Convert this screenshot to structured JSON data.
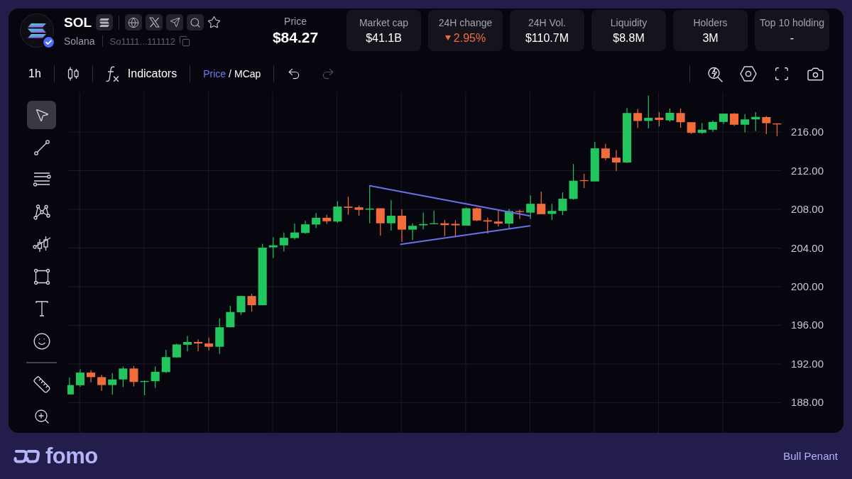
{
  "token": {
    "symbol": "SOL",
    "name": "Solana",
    "address": "So1111...111112",
    "verified": true
  },
  "price": {
    "label": "Price",
    "value": "$84.27"
  },
  "stats": [
    {
      "label": "Market cap",
      "value": "$41.1B"
    },
    {
      "label": "24H change",
      "value": "2.95%",
      "negative": true
    },
    {
      "label": "24H Vol.",
      "value": "$110.7M"
    },
    {
      "label": "Liquidity",
      "value": "$8.8M"
    },
    {
      "label": "Holders",
      "value": "3M"
    },
    {
      "label": "Top 10 holding",
      "value": "-"
    }
  ],
  "toolbar": {
    "interval": "1h",
    "indicators": "Indicators",
    "modes": [
      {
        "label": "Price",
        "selected": true
      },
      {
        "label": "MCap",
        "selected": false
      }
    ],
    "mode_separator": "/",
    "history": [
      {
        "kind": "undo",
        "disabled": false
      },
      {
        "kind": "redo",
        "disabled": true
      }
    ]
  },
  "drawing_tools": [
    {
      "kind": "cursor",
      "selected": true
    },
    {
      "kind": "trend_line",
      "selected": false
    },
    {
      "kind": "parallel_lines",
      "selected": false
    },
    {
      "kind": "pattern",
      "selected": false
    },
    {
      "kind": "candles_line",
      "selected": false
    },
    {
      "kind": "rectangle",
      "selected": false
    },
    {
      "kind": "text",
      "selected": false
    },
    {
      "kind": "emoji",
      "selected": false
    }
  ],
  "utility_tools": [
    {
      "kind": "ruler",
      "selected": false
    },
    {
      "kind": "zoom",
      "selected": false
    }
  ],
  "chart": {
    "chart_data": {
      "type": "candlestick",
      "categories": [
        null,
        null,
        null,
        null,
        null,
        null,
        null,
        null,
        null,
        null,
        null,
        null,
        null,
        null,
        null,
        null,
        null,
        null,
        null,
        null,
        null,
        null,
        null,
        null,
        null,
        null,
        null,
        null,
        null,
        null,
        null,
        null,
        null,
        null,
        null,
        null,
        null,
        null,
        null,
        null,
        null,
        null,
        null,
        null,
        null,
        null,
        null,
        null,
        null,
        null,
        null,
        null,
        null,
        null,
        null,
        null,
        null,
        null,
        null,
        null,
        null,
        null,
        null,
        null,
        null,
        null,
        null
      ],
      "ohlc": [
        [
          188.85,
          190.61,
          188.85,
          189.82
        ],
        [
          189.8,
          191.45,
          189.64,
          191.11
        ],
        [
          191.11,
          191.37,
          190.09,
          190.64
        ],
        [
          190.64,
          190.87,
          189.22,
          189.82
        ],
        [
          189.82,
          191.06,
          188.83,
          190.4
        ],
        [
          190.4,
          191.74,
          189.61,
          191.53
        ],
        [
          191.53,
          191.79,
          189.67,
          190.14
        ],
        [
          190.14,
          190.29,
          188.77,
          190.24
        ],
        [
          190.22,
          191.74,
          189.53,
          191.19
        ],
        [
          191.16,
          193.47,
          191.06,
          192.71
        ],
        [
          192.68,
          194.1,
          192.66,
          194.02
        ],
        [
          193.99,
          194.89,
          193.31,
          194.28
        ],
        [
          194.28,
          194.54,
          193.31,
          194.12
        ],
        [
          194.12,
          194.73,
          193.42,
          193.78
        ],
        [
          193.78,
          196.72,
          193.05,
          195.8
        ],
        [
          195.8,
          198.01,
          195.78,
          197.38
        ],
        [
          197.35,
          199.06,
          197.09,
          199.03
        ],
        [
          199.03,
          199.27,
          197.43,
          198.08
        ],
        [
          198.08,
          204.43,
          198.08,
          204.04
        ],
        [
          204.07,
          205.11,
          202.96,
          204.28
        ],
        [
          204.28,
          205.61,
          203.65,
          205.06
        ],
        [
          205.03,
          206.53,
          204.88,
          205.61
        ],
        [
          205.56,
          206.82,
          205.48,
          206.45
        ],
        [
          206.43,
          207.61,
          206.06,
          207.13
        ],
        [
          207.13,
          207.45,
          206.5,
          206.77
        ],
        [
          206.74,
          208.84,
          206.61,
          208.29
        ],
        [
          208.29,
          209.31,
          207.45,
          208.16
        ],
        [
          208.21,
          208.39,
          207.34,
          207.95
        ],
        [
          207.97,
          210.44,
          206.56,
          208.08
        ],
        [
          208.11,
          208.11,
          205.27,
          206.56
        ],
        [
          206.56,
          208.94,
          205.8,
          207.34
        ],
        [
          207.34,
          208.0,
          204.62,
          205.9
        ],
        [
          205.9,
          206.56,
          204.83,
          206.3
        ],
        [
          206.35,
          207.66,
          205.93,
          206.48
        ],
        [
          206.48,
          207.87,
          206.48,
          206.56
        ],
        [
          206.56,
          206.9,
          205.22,
          206.37
        ],
        [
          206.5,
          206.87,
          205.11,
          206.35
        ],
        [
          206.32,
          208.18,
          206.32,
          208.11
        ],
        [
          208.11,
          208.18,
          206.79,
          206.85
        ],
        [
          206.87,
          207.16,
          205.48,
          206.74
        ],
        [
          206.74,
          207.9,
          206.22,
          206.53
        ],
        [
          206.53,
          208.05,
          206.03,
          207.82
        ],
        [
          207.82,
          207.97,
          207.0,
          207.74
        ],
        [
          207.66,
          209.44,
          207.0,
          208.58
        ],
        [
          208.58,
          209.84,
          207.5,
          207.5
        ],
        [
          207.53,
          208.58,
          206.9,
          207.84
        ],
        [
          207.84,
          209.76,
          207.42,
          209.1
        ],
        [
          209.08,
          212.7,
          209.0,
          210.96
        ],
        [
          211.02,
          211.67,
          210.2,
          210.94
        ],
        [
          210.89,
          214.98,
          210.89,
          214.32
        ],
        [
          214.3,
          214.77,
          213.09,
          213.3
        ],
        [
          213.35,
          214.14,
          211.96,
          212.85
        ],
        [
          212.85,
          218.49,
          212.8,
          217.97
        ],
        [
          217.97,
          218.39,
          216.42,
          217.15
        ],
        [
          217.15,
          219.78,
          216.37,
          217.47
        ],
        [
          217.49,
          218.07,
          216.58,
          217.26
        ],
        [
          217.21,
          218.44,
          217.08,
          217.99
        ],
        [
          217.97,
          218.44,
          216.45,
          217.02
        ],
        [
          217.02,
          217.02,
          215.82,
          215.92
        ],
        [
          215.92,
          216.94,
          215.82,
          216.24
        ],
        [
          216.24,
          217.21,
          216.03,
          217.05
        ],
        [
          217.05,
          217.91,
          216.84,
          217.91
        ],
        [
          217.91,
          217.97,
          216.63,
          216.76
        ],
        [
          216.76,
          217.86,
          215.97,
          217.31
        ],
        [
          217.31,
          218.07,
          216.1,
          217.57
        ],
        [
          217.55,
          217.65,
          215.79,
          216.92
        ],
        [
          216.89,
          216.89,
          215.58,
          216.84
        ]
      ],
      "ylim": [
        184.87,
        220.12
      ],
      "yticks": [
        {
          "value": 216,
          "label": "216.00"
        },
        {
          "value": 212,
          "label": "212.00"
        },
        {
          "value": 208,
          "label": "208.00"
        },
        {
          "value": 204,
          "label": "204.00"
        },
        {
          "value": 200,
          "label": "200.00"
        },
        {
          "value": 196,
          "label": "196.00"
        },
        {
          "value": 192,
          "label": "192.00"
        },
        {
          "value": 188,
          "label": "188.00"
        }
      ],
      "grid": true
    }
  },
  "footer": {
    "brand": "fomo",
    "pattern": "Bull Penant"
  }
}
